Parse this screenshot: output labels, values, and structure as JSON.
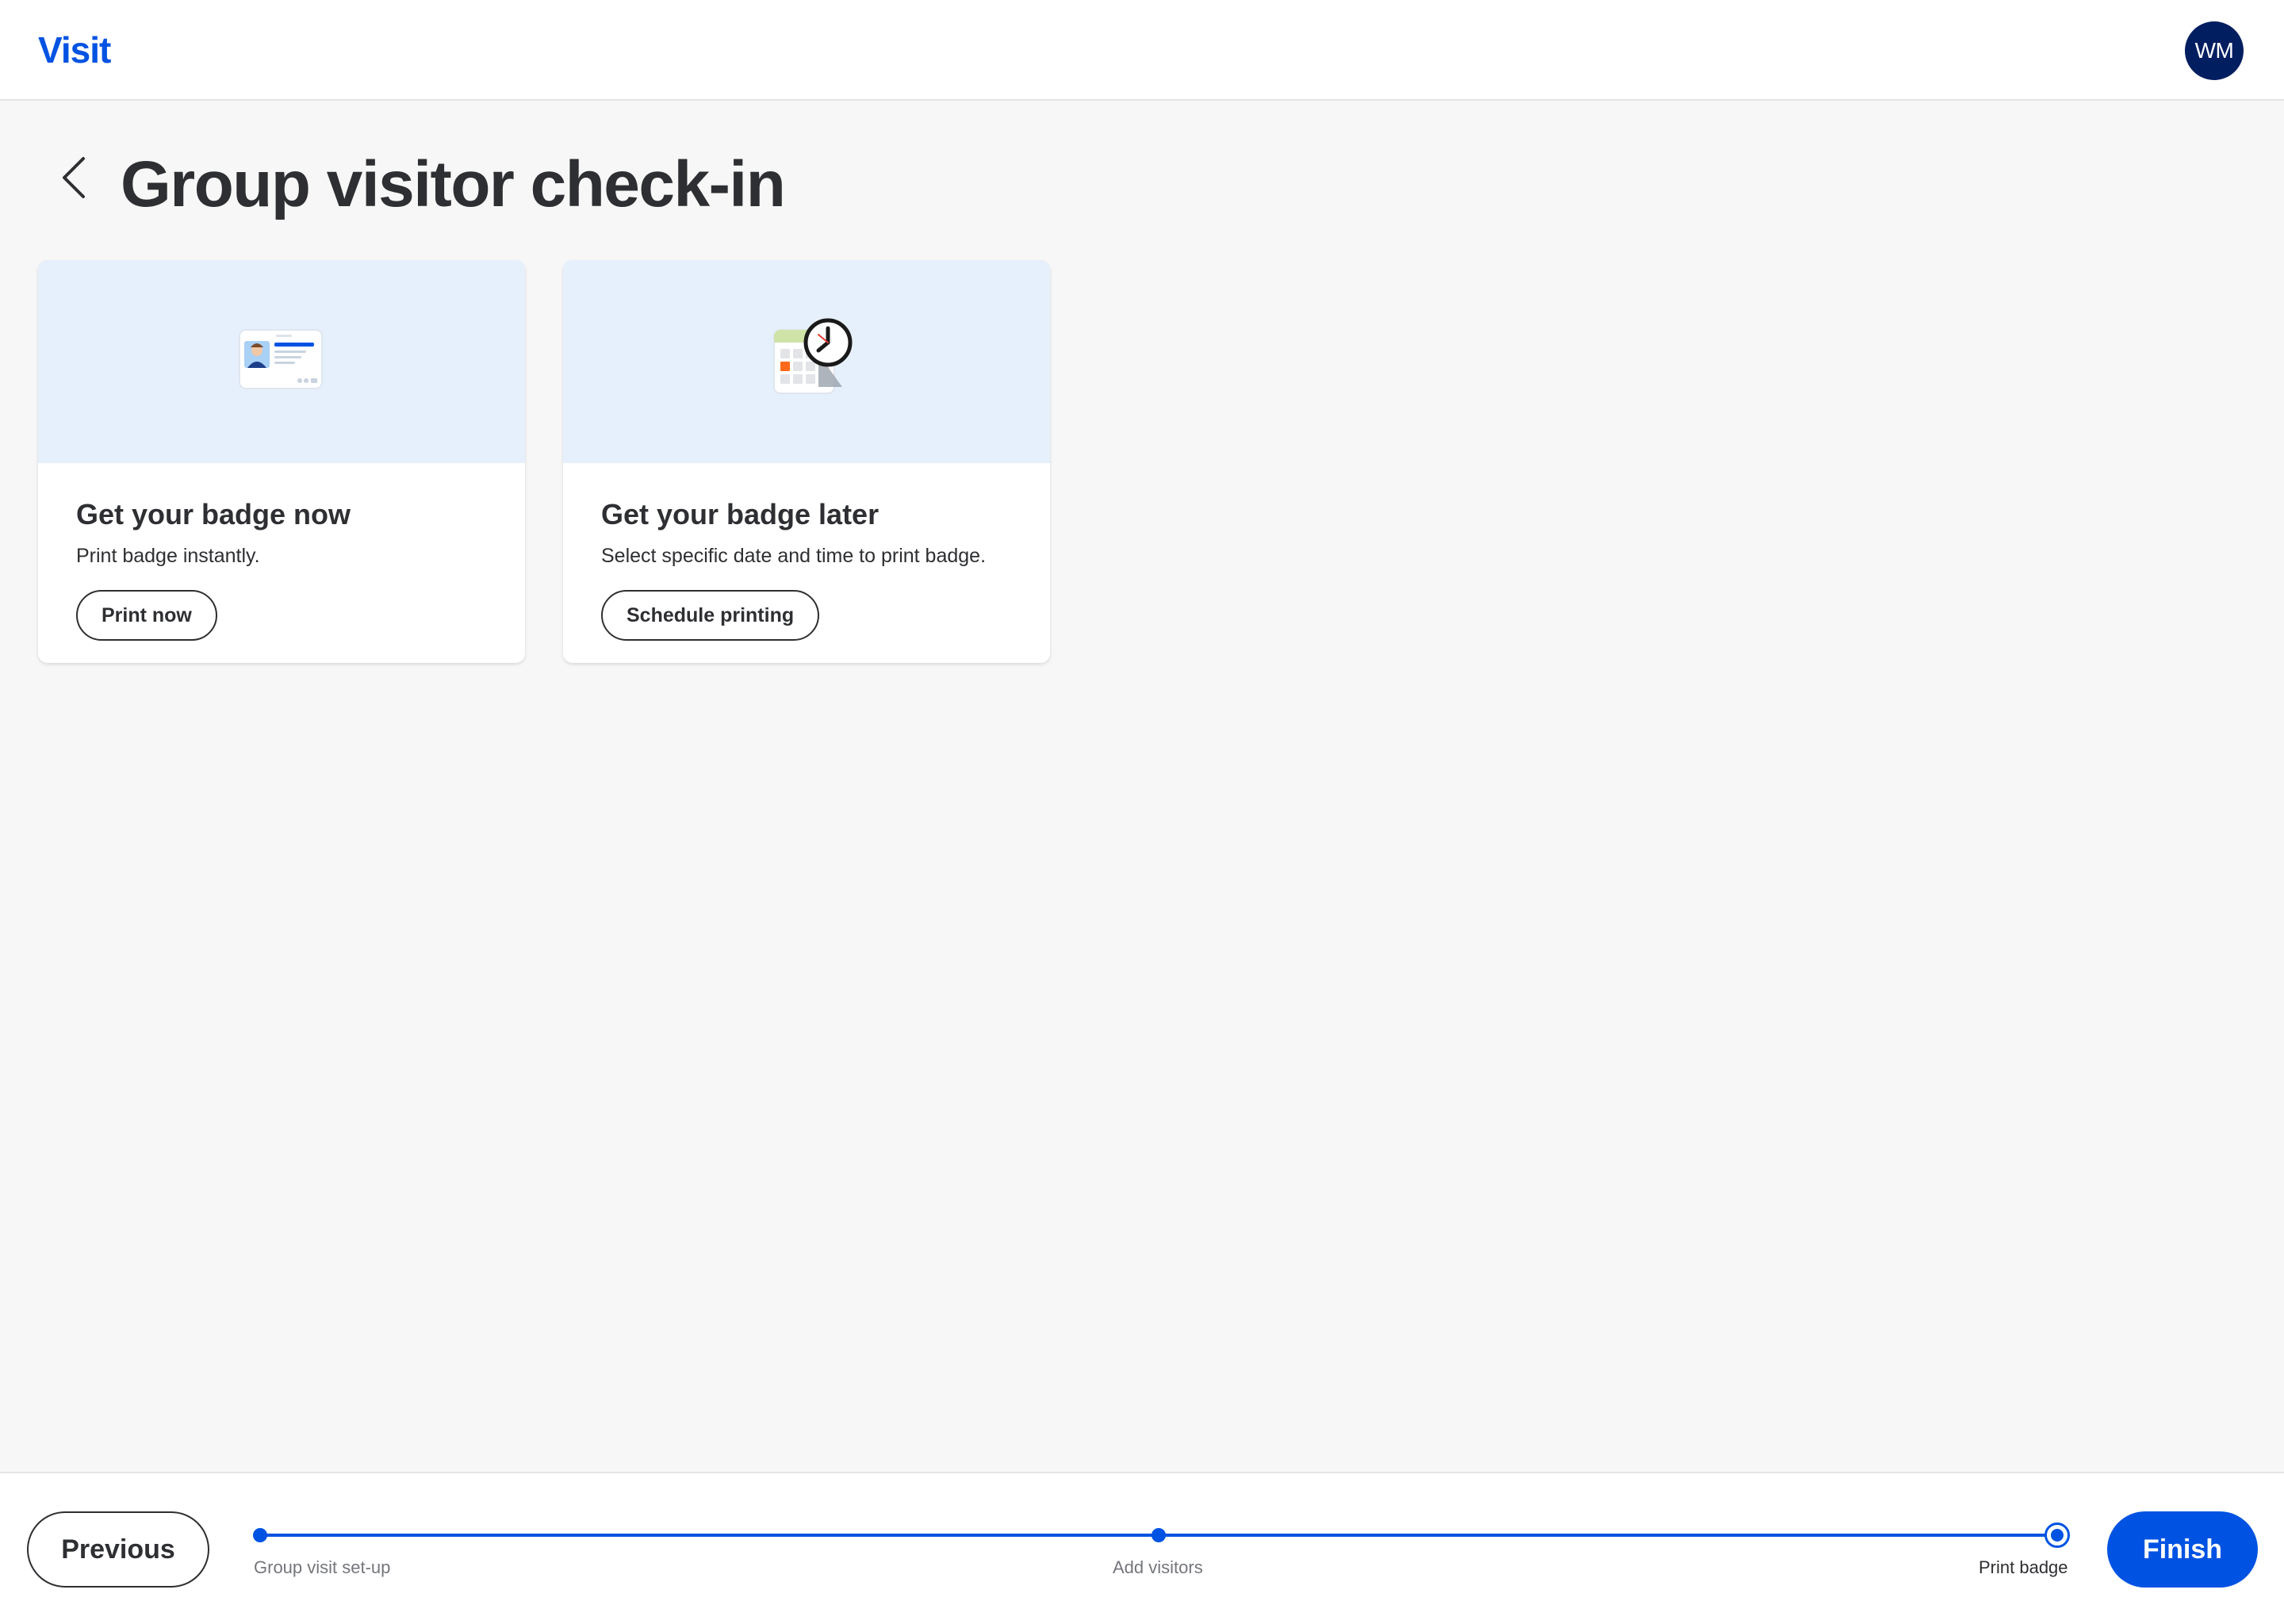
{
  "header": {
    "brand": "Visit",
    "avatar_initials": "WM"
  },
  "page": {
    "title": "Group visitor check-in",
    "back_icon": "chevron-left-icon"
  },
  "cards": [
    {
      "illustration": "id-badge-icon",
      "heading": "Get your badge now",
      "description": "Print badge instantly.",
      "button_label": "Print now"
    },
    {
      "illustration": "calendar-clock-icon",
      "heading": "Get your badge later",
      "description": "Select specific date and time to print badge.",
      "button_label": "Schedule printing"
    }
  ],
  "footer": {
    "previous_label": "Previous",
    "finish_label": "Finish",
    "steps": [
      {
        "label": "Group visit set-up",
        "state": "complete"
      },
      {
        "label": "Add visitors",
        "state": "complete"
      },
      {
        "label": "Print badge",
        "state": "current"
      }
    ]
  },
  "colors": {
    "brand": "#0053e2",
    "avatar": "#001e60",
    "illustration_bg": "#e6f0fc",
    "text": "#2e2f32"
  }
}
